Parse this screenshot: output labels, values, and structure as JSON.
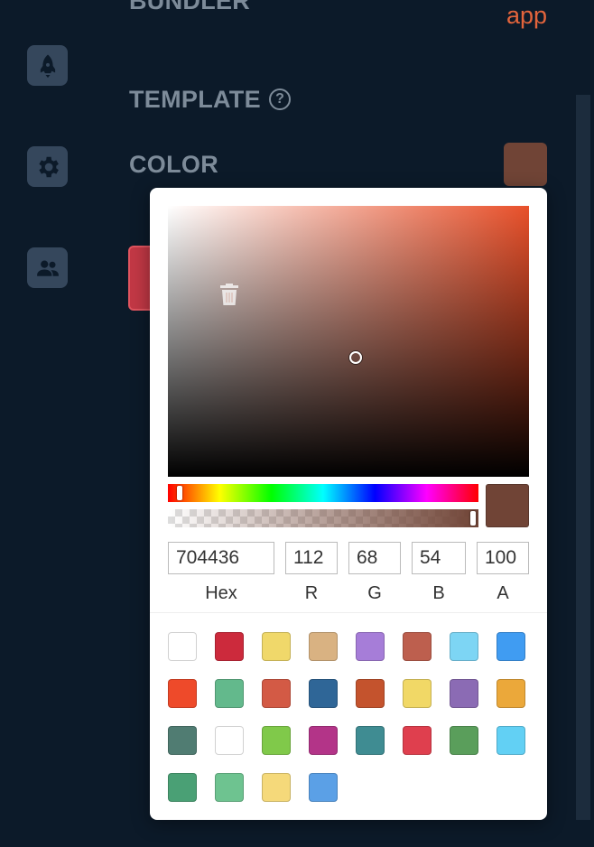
{
  "sidebar": {
    "icons": [
      {
        "name": "rocket-icon"
      },
      {
        "name": "gear-icon"
      },
      {
        "name": "people-icon"
      }
    ]
  },
  "labels": {
    "bundler": "BUNDLER",
    "template": "TEMPLATE",
    "template_help": "?",
    "color": "COLOR",
    "app_link": "app"
  },
  "current_color": "#704436",
  "picker": {
    "sv_cursor": {
      "saturation": 0.52,
      "value": 0.44
    },
    "hue": 14,
    "alpha": 1.0,
    "fields": {
      "hex": {
        "value": "704436",
        "label": "Hex"
      },
      "r": {
        "value": "112",
        "label": "R"
      },
      "g": {
        "value": "68",
        "label": "G"
      },
      "b": {
        "value": "54",
        "label": "B"
      },
      "a": {
        "value": "100",
        "label": "A"
      }
    },
    "preset_colors": [
      "#ffffff",
      "#cc2a3c",
      "#f0d86a",
      "#d9b282",
      "#a67dd8",
      "#bd5f4e",
      "#7dd5f4",
      "#409cf2",
      "#ee4a2a",
      "#63b98c",
      "#d35a45",
      "#2f6697",
      "#c4532d",
      "#f1d866",
      "#8b6bb4",
      "#eba83a",
      "#507c72",
      "#ffffff",
      "#80c94a",
      "#b33488",
      "#3f8c92",
      "#df3f4e",
      "#5a9e5b",
      "#62d0f4",
      "#4aa075",
      "#6ec390",
      "#f5d97a",
      "#5ba0e6"
    ]
  }
}
